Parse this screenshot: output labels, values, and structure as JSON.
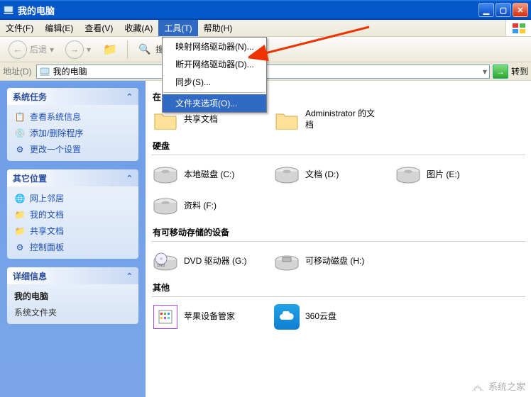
{
  "title": "我的电脑",
  "menubar": [
    "文件(F)",
    "编辑(E)",
    "查看(V)",
    "收藏(A)",
    "工具(T)",
    "帮助(H)"
  ],
  "menubar_active_index": 4,
  "dropdown": {
    "items": [
      "映射网络驱动器(N)...",
      "断开网络驱动器(D)...",
      "同步(S)..."
    ],
    "highlighted": "文件夹选项(O)..."
  },
  "toolbar": {
    "back": "后退",
    "search": "搜索"
  },
  "addressbar": {
    "label": "地址(D)",
    "value": "我的电脑",
    "go": "转到"
  },
  "sidebar": {
    "panels": [
      {
        "title": "系统任务",
        "items": [
          "查看系统信息",
          "添加/删除程序",
          "更改一个设置"
        ],
        "icons": [
          "ℹ",
          "➕",
          "⚙"
        ]
      },
      {
        "title": "其它位置",
        "items": [
          "网上邻居",
          "我的文档",
          "共享文档",
          "控制面板"
        ],
        "icons": [
          "🌐",
          "📁",
          "📁",
          "⚙"
        ]
      },
      {
        "title": "详细信息",
        "details": {
          "name": "我的电脑",
          "type": "系统文件夹"
        }
      }
    ]
  },
  "main": {
    "sections": [
      {
        "label": "在",
        "kind": "folders",
        "items": [
          {
            "name": "共享文档"
          },
          {
            "name": "Administrator 的文档"
          }
        ]
      },
      {
        "label": "硬盘",
        "kind": "drives",
        "items": [
          {
            "name": "本地磁盘 (C:)"
          },
          {
            "name": "文档 (D:)"
          },
          {
            "name": "图片 (E:)"
          },
          {
            "name": "资料 (F:)"
          }
        ]
      },
      {
        "label": "有可移动存储的设备",
        "kind": "removable",
        "items": [
          {
            "name": "DVD 驱动器 (G:)",
            "type": "dvd"
          },
          {
            "name": "可移动磁盘 (H:)",
            "type": "removable"
          }
        ]
      },
      {
        "label": "其他",
        "kind": "other",
        "items": [
          {
            "name": "苹果设备管家",
            "type": "app"
          },
          {
            "name": "360云盘",
            "type": "cloud"
          }
        ]
      }
    ]
  },
  "watermark": "系统之家"
}
